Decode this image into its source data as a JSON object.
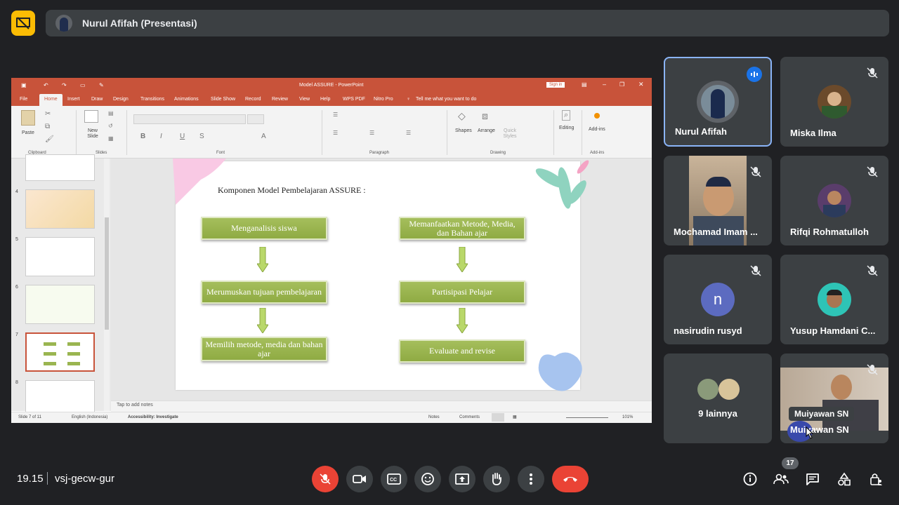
{
  "top": {
    "presenter_label": "Nurul Afifah (Presentasi)"
  },
  "ppt": {
    "doc_title": "Model ASSURE  -  PowerPoint",
    "signin": "Sign in",
    "tabs": [
      "File",
      "Home",
      "Insert",
      "Draw",
      "Design",
      "Transitions",
      "Animations",
      "Slide Show",
      "Record",
      "Review",
      "View",
      "Help",
      "WPS PDF",
      "Nitro Pro"
    ],
    "tell_me": "Tell me what you want to do",
    "ribbon": {
      "paste": "Paste",
      "new_slide": "New Slide",
      "groups": [
        "Clipboard",
        "Slides",
        "Font",
        "Paragraph",
        "Drawing",
        "Add-ins"
      ],
      "shapes": "Shapes",
      "arrange": "Arrange",
      "quick_styles": "Quick Styles",
      "editing": "Editing",
      "addins": "Add-ins"
    },
    "thumb_numbers": [
      "4",
      "5",
      "6",
      "7",
      "8"
    ],
    "slide": {
      "title": "Komponen Model Pembelajaran ASSURE :",
      "left": [
        "Menganalisis siswa",
        "Merumuskan tujuan pembelajaran",
        "Memilih metode, media dan bahan ajar"
      ],
      "right": [
        "Memanfaatkan Metode, Media, dan Bahan ajar",
        "Partisipasi Pelajar",
        "Evaluate and revise"
      ]
    },
    "notes_placeholder": "Tap to add notes",
    "status": {
      "slide": "Slide 7 of 11",
      "language": "English (Indonesia)",
      "accessibility": "Accessibility: Investigate",
      "notes": "Notes",
      "comments": "Comments",
      "zoom": "101%"
    }
  },
  "participants": [
    {
      "name": "Nurul Afifah",
      "speaking": true
    },
    {
      "name": "Miska Ilma"
    },
    {
      "name": "Mochamad Imam ..."
    },
    {
      "name": "Rifqi Rohmatulloh"
    },
    {
      "name": "nasirudin rusyd",
      "initial": "n"
    },
    {
      "name": "Yusup Hamdani C..."
    },
    {
      "name": "9 lainnya"
    },
    {
      "name": "Muiyawan SN",
      "tooltip": "Muiyawan SN"
    }
  ],
  "bottom": {
    "time": "19.15",
    "meeting_code": "vsj-gecw-gur",
    "people_count": "17"
  },
  "colors": {
    "background": "#202124",
    "tile": "#3c4043",
    "end_call": "#ea4335",
    "accent_yellow": "#fbbc04",
    "ppt_red": "#c8533a",
    "slide_green": "#9ab550"
  }
}
